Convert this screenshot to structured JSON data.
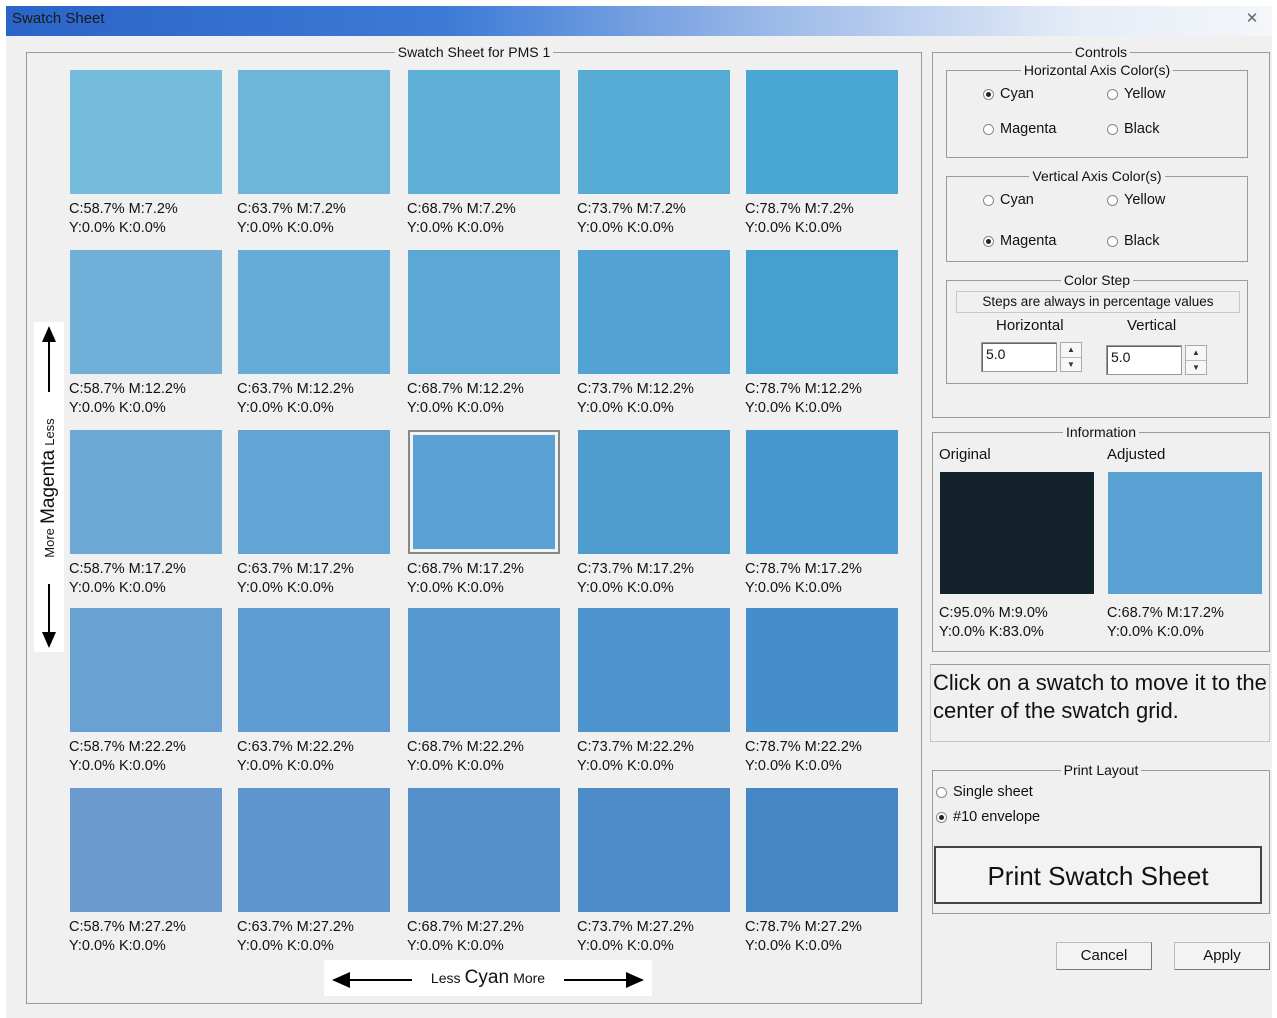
{
  "window": {
    "title": "Swatch Sheet",
    "close_glyph": "✕"
  },
  "sheet": {
    "title": "Swatch Sheet for PMS 1",
    "rows": [
      [
        {
          "c": "C:58.7% M:7.2%",
          "k": "Y:0.0% K:0.0%",
          "color": "#75bbdb"
        },
        {
          "c": "C:63.7% M:7.2%",
          "k": "Y:0.0% K:0.0%",
          "color": "#6cb6d9"
        },
        {
          "c": "C:68.7% M:7.2%",
          "k": "Y:0.0% K:0.0%",
          "color": "#5fb0d7"
        },
        {
          "c": "C:73.7% M:7.2%",
          "k": "Y:0.0% K:0.0%",
          "color": "#57acd6"
        },
        {
          "c": "C:78.7% M:7.2%",
          "k": "Y:0.0% K:0.0%",
          "color": "#4aa6d3"
        }
      ],
      [
        {
          "c": "C:58.7% M:12.2%",
          "k": "Y:0.0% K:0.0%",
          "color": "#70b0d8"
        },
        {
          "c": "C:63.7% M:12.2%",
          "k": "Y:0.0% K:0.0%",
          "color": "#65acd7"
        },
        {
          "c": "C:68.7% M:12.2%",
          "k": "Y:0.0% K:0.0%",
          "color": "#5ba8d5"
        },
        {
          "c": "C:73.7% M:12.2%",
          "k": "Y:0.0% K:0.0%",
          "color": "#52a3d3"
        },
        {
          "c": "C:78.7% M:12.2%",
          "k": "Y:0.0% K:0.0%",
          "color": "#469fd1"
        }
      ],
      [
        {
          "c": "C:58.7% M:17.2%",
          "k": "Y:0.0% K:0.0%",
          "color": "#6ca9d5"
        },
        {
          "c": "C:63.7% M:17.2%",
          "k": "Y:0.0% K:0.0%",
          "color": "#62a5d4"
        },
        {
          "c": "C:68.7% M:17.2%",
          "k": "Y:0.0% K:0.0%",
          "color": "#58a1d2",
          "selected": true
        },
        {
          "c": "C:73.7% M:17.2%",
          "k": "Y:0.0% K:0.0%",
          "color": "#4f9ccf"
        },
        {
          "c": "C:78.7% M:17.2%",
          "k": "Y:0.0% K:0.0%",
          "color": "#4697cd"
        }
      ],
      [
        {
          "c": "C:58.7% M:22.2%",
          "k": "Y:0.0% K:0.0%",
          "color": "#69a1d3"
        },
        {
          "c": "C:63.7% M:22.2%",
          "k": "Y:0.0% K:0.0%",
          "color": "#5f9cd1"
        },
        {
          "c": "C:68.7% M:22.2%",
          "k": "Y:0.0% K:0.0%",
          "color": "#5598cf"
        },
        {
          "c": "C:73.7% M:22.2%",
          "k": "Y:0.0% K:0.0%",
          "color": "#4d93cd"
        },
        {
          "c": "C:78.7% M:22.2%",
          "k": "Y:0.0% K:0.0%",
          "color": "#448fcb"
        }
      ],
      [
        {
          "c": "C:58.7% M:27.2%",
          "k": "Y:0.0% K:0.0%",
          "color": "#6b9ace"
        },
        {
          "c": "C:63.7% M:27.2%",
          "k": "Y:0.0% K:0.0%",
          "color": "#5e95cc"
        },
        {
          "c": "C:68.7% M:27.2%",
          "k": "Y:0.0% K:0.0%",
          "color": "#5590ca"
        },
        {
          "c": "C:73.7% M:27.2%",
          "k": "Y:0.0% K:0.0%",
          "color": "#4d8cc8"
        },
        {
          "c": "C:78.7% M:27.2%",
          "k": "Y:0.0% K:0.0%",
          "color": "#4587c4"
        }
      ]
    ],
    "axis_h": {
      "less": "Less",
      "name": "Cyan",
      "more": "More"
    },
    "axis_v": {
      "less": "Less",
      "name": "Magenta",
      "more": "More"
    }
  },
  "controls": {
    "title": "Controls",
    "horizontal_axis": {
      "title": "Horizontal Axis Color(s)",
      "options": [
        {
          "label": "Cyan",
          "checked": true
        },
        {
          "label": "Yellow",
          "checked": false
        },
        {
          "label": "Magenta",
          "checked": false
        },
        {
          "label": "Black",
          "checked": false
        }
      ]
    },
    "vertical_axis": {
      "title": "Vertical Axis Color(s)",
      "options": [
        {
          "label": "Cyan",
          "checked": false
        },
        {
          "label": "Yellow",
          "checked": false
        },
        {
          "label": "Magenta",
          "checked": true
        },
        {
          "label": "Black",
          "checked": false
        }
      ]
    },
    "color_step": {
      "title": "Color Step",
      "note": "Steps are always in percentage values",
      "horizontal_label": "Horizontal",
      "vertical_label": "Vertical",
      "horizontal_value": "5.0",
      "vertical_value": "5.0"
    }
  },
  "information": {
    "title": "Information",
    "original_label": "Original",
    "adjusted_label": "Adjusted",
    "original_color": "#13222b",
    "adjusted_color": "#58a1d2",
    "original_c": "C:95.0% M:9.0%",
    "original_k": "Y:0.0% K:83.0%",
    "adjusted_c": "C:68.7% M:17.2%",
    "adjusted_k": "Y:0.0% K:0.0%"
  },
  "hint": "Click on a swatch to move it to the center of the swatch grid.",
  "print_layout": {
    "title": "Print Layout",
    "options": [
      {
        "label": "Single sheet",
        "checked": false
      },
      {
        "label": "#10 envelope",
        "checked": true
      }
    ]
  },
  "buttons": {
    "print": "Print Swatch Sheet",
    "cancel": "Cancel",
    "apply": "Apply"
  }
}
